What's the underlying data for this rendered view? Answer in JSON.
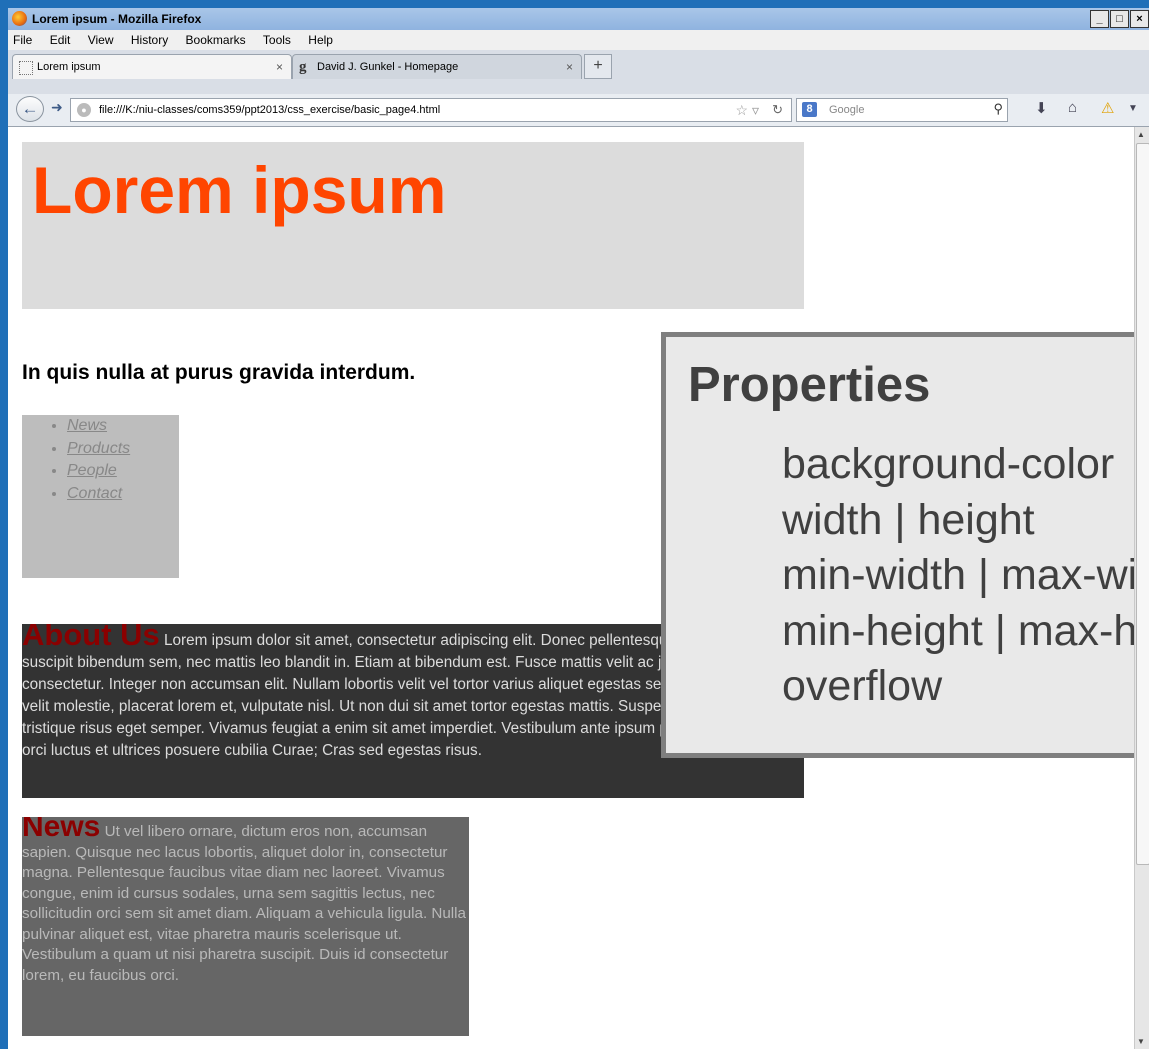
{
  "window": {
    "title": "Lorem ipsum - Mozilla Firefox",
    "buttons": [
      "_",
      "□",
      "×"
    ]
  },
  "menu": {
    "items": [
      "File",
      "Edit",
      "View",
      "History",
      "Bookmarks",
      "Tools",
      "Help"
    ]
  },
  "tabs": [
    {
      "label": "Lorem ipsum",
      "close": "×"
    },
    {
      "label": "David J. Gunkel - Homepage",
      "close": "×"
    }
  ],
  "new_tab": "+",
  "address": {
    "url": "file:///K:/niu-classes/coms359/ppt2013/css_exercise/basic_page4.html"
  },
  "search": {
    "engine_glyph": "8",
    "placeholder": "Google"
  },
  "page": {
    "heading": "Lorem ipsum",
    "subheading": "In quis nulla at purus gravida interdum.",
    "nav_links": [
      "News",
      "Products",
      "People",
      "Contact"
    ],
    "about": {
      "title": "About Us",
      "body": "Lorem ipsum dolor sit amet, consectetur adipiscing elit. Donec pellentesque varius leo. Ut suscipit bibendum sem, nec mattis leo blandit in. Etiam at bibendum est. Fusce mattis velit ac justo dignissim consectetur. Integer non accumsan elit. Nullam lobortis velit vel tortor varius aliquet egestas sed diam. Quisque id velit molestie, placerat lorem et, vulputate nisl. Ut non dui sit amet tortor egestas mattis. Suspendisse tempor tristique risus eget semper. Vivamus feugiat a enim sit amet imperdiet. Vestibulum ante ipsum primis in faucibus orci luctus et ultrices posuere cubilia Curae; Cras sed egestas risus."
    },
    "news": {
      "title": "News",
      "body": "Ut vel libero ornare, dictum eros non, accumsan sapien. Quisque nec lacus lobortis, aliquet dolor in, consectetur magna. Pellentesque faucibus vitae diam nec laoreet. Vivamus congue, enim id cursus sodales, urna sem sagittis lectus, nec sollicitudin orci sem sit amet diam. Aliquam a vehicula ligula. Nulla pulvinar aliquet est, vitae pharetra mauris scelerisque ut. Vestibulum a quam ut nisi pharetra suscipit. Duis id consectetur lorem, eu faucibus orci."
    }
  },
  "callout": {
    "title": "Properties",
    "items": [
      "background-color",
      "width | height",
      "min-width | max-width",
      "min-height | max-height",
      "overflow"
    ]
  },
  "colors": {
    "heading": "#ff4500",
    "section_title": "#8b0000",
    "header_bg": "#dcdcdc",
    "nav_bg": "#bdbdbd",
    "about_bg": "#333333",
    "news_bg": "#666666"
  }
}
